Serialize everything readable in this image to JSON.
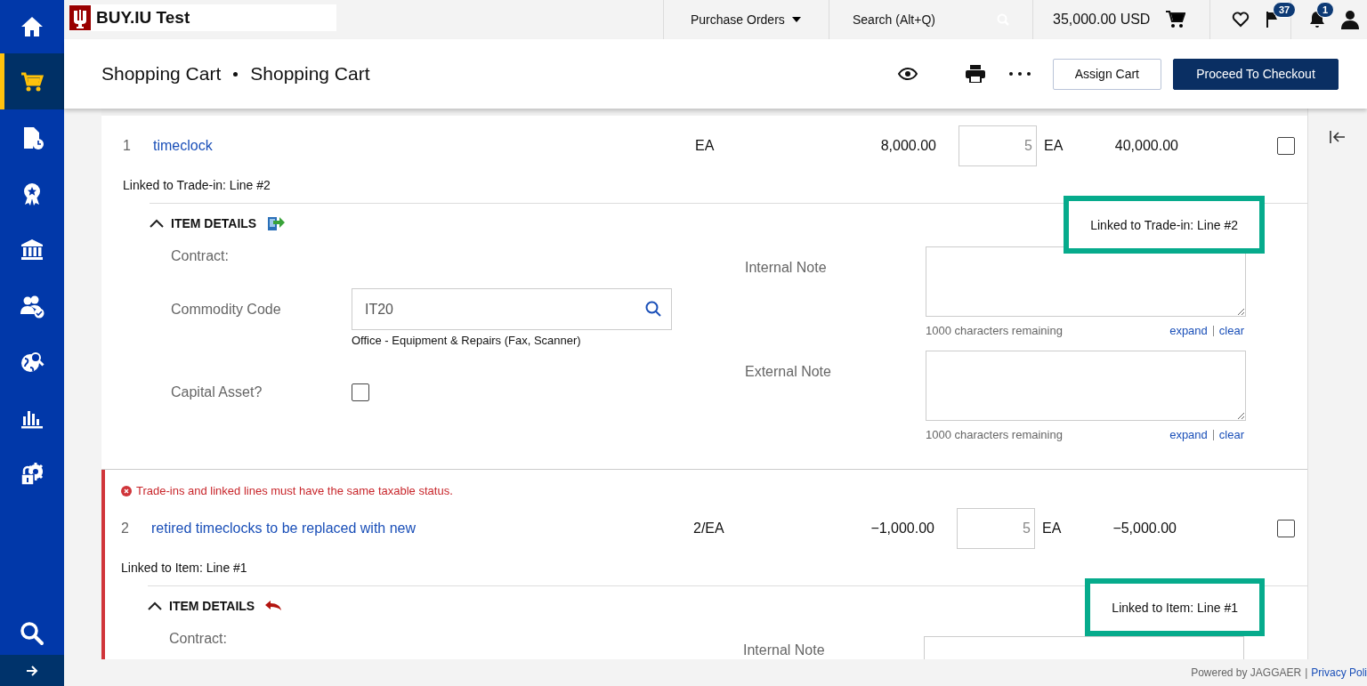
{
  "sidebar": {
    "items": [
      {
        "kind": "home",
        "selected": false
      },
      {
        "kind": "cart",
        "selected": true
      },
      {
        "kind": "document-clock",
        "selected": false
      },
      {
        "kind": "award",
        "selected": false
      },
      {
        "kind": "bank",
        "selected": false
      },
      {
        "kind": "users",
        "selected": false
      },
      {
        "kind": "globe-search",
        "selected": false
      },
      {
        "kind": "bar-chart",
        "selected": false
      },
      {
        "kind": "lock-gear",
        "selected": false
      }
    ]
  },
  "topbar": {
    "logo_text": "BUY.IU Test",
    "menu": "Purchase Orders",
    "search": {
      "placeholder": "Search (Alt+Q)"
    },
    "cart_total": "35,000.00 USD",
    "flag_count": "37",
    "notification_count": "1"
  },
  "page_header": {
    "breadcrumb": [
      "Shopping Cart",
      "Shopping Cart"
    ],
    "buttons": [
      {
        "label": "Assign Cart",
        "kind": "secondary"
      },
      {
        "label": "Proceed To Checkout",
        "kind": "primary"
      }
    ]
  },
  "lines": [
    {
      "number": "1",
      "name": "timeclock",
      "size": "EA",
      "unit_price": "8,000.00",
      "quantity": "5",
      "uom": "EA",
      "ext_price": "40,000.00",
      "checked": false,
      "kind": "trade-in",
      "link_text": "Linked to Trade-in: Line #2",
      "callout": "Linked to Trade-in: Line #2",
      "details": {
        "title": "ITEM DETAILS",
        "expanded": true,
        "contract_label": "Contract:",
        "commodity_label": "Commodity Code",
        "commodity_value": "IT20",
        "commodity_description": "Office - Equipment & Repairs (Fax, Scanner)",
        "capital_asset_label": "Capital Asset?",
        "capital_asset_checked": false,
        "notes": [
          {
            "label": "Internal Note",
            "remaining": "1000 characters remaining",
            "expand": "expand",
            "clear": "clear"
          },
          {
            "label": "External Note",
            "remaining": "1000 characters remaining",
            "expand": "expand",
            "clear": "clear"
          }
        ]
      }
    },
    {
      "number": "2",
      "name": "retired timeclocks to be replaced with new",
      "size": "2/EA",
      "unit_price": "−1,000.00",
      "quantity": "5",
      "uom": "EA",
      "ext_price": "−5,000.00",
      "checked": false,
      "error": "Trade-ins and linked lines must have the same taxable status.",
      "kind": "item",
      "link_text": "Linked to Item: Line #1",
      "callout": "Linked to Item: Line #1",
      "details": {
        "title": "ITEM DETAILS",
        "expanded": true,
        "contract_label": "Contract:",
        "notes": [
          {
            "label": "Internal Note"
          }
        ]
      }
    }
  ],
  "footer": {
    "powered_by": "Powered by JAGGAER",
    "separator": "|",
    "link": "Privacy Poli"
  }
}
